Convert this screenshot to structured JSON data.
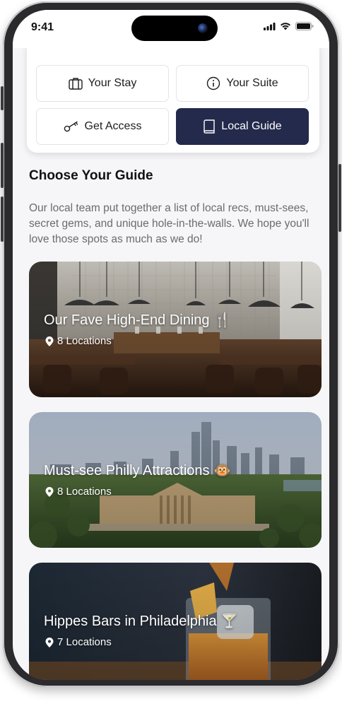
{
  "status_bar": {
    "time": "9:41"
  },
  "tabs": [
    {
      "label": "Your Stay",
      "icon": "suitcase-icon"
    },
    {
      "label": "Your Suite",
      "icon": "info-icon"
    },
    {
      "label": "Get Access",
      "icon": "key-icon"
    },
    {
      "label": "Local Guide",
      "icon": "book-icon",
      "active": true
    }
  ],
  "section": {
    "title": "Choose Your Guide",
    "description": "Our local team put together a list of local recs, must-sees, secret gems, and unique hole-in-the-walls. We hope you'll love those spots as much as we do!"
  },
  "guides": [
    {
      "title": "Our Fave High-End Dining 🍴",
      "locations": "8 Locations"
    },
    {
      "title": "Must-see Philly Attractions 🐵",
      "locations": "8 Locations"
    },
    {
      "title": "Hippes Bars in Philadelphia 🍸",
      "locations": "7 Locations"
    }
  ],
  "colors": {
    "active_tab": "#232a4b",
    "text_muted": "#6b6b70"
  }
}
